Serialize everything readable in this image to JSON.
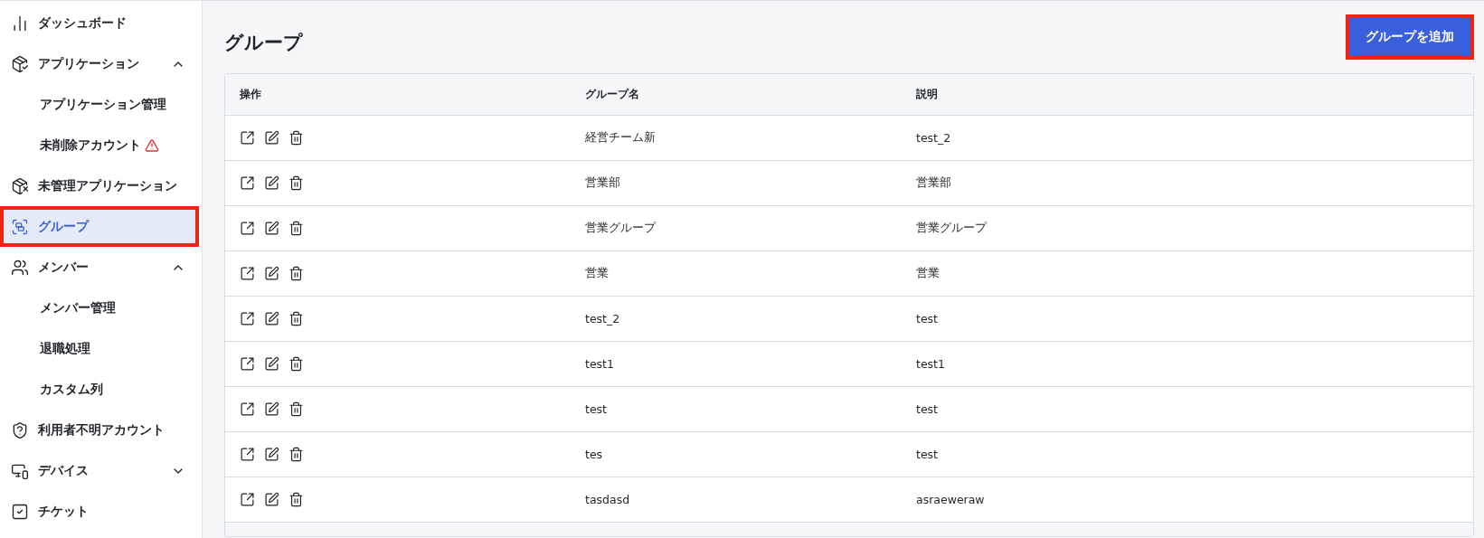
{
  "sidebar": {
    "items": [
      {
        "label": "ダッシュボード",
        "selected": false,
        "outlined": false
      },
      {
        "label": "アプリケーション",
        "selected": false,
        "outlined": false,
        "expanded": true,
        "children": [
          {
            "label": "アプリケーション管理",
            "selected": false,
            "warning": false
          },
          {
            "label": "未削除アカウント",
            "selected": false,
            "warning": true
          }
        ]
      },
      {
        "label": "未管理アプリケーション",
        "selected": false,
        "outlined": false
      },
      {
        "label": "グループ",
        "selected": true,
        "outlined": true
      },
      {
        "label": "メンバー",
        "selected": false,
        "outlined": false,
        "expanded": true,
        "children": [
          {
            "label": "メンバー管理",
            "selected": false,
            "warning": false
          },
          {
            "label": "退職処理",
            "selected": false,
            "warning": false
          },
          {
            "label": "カスタム列",
            "selected": false,
            "warning": false
          }
        ]
      },
      {
        "label": "利用者不明アカウント",
        "selected": false,
        "outlined": false
      },
      {
        "label": "デバイス",
        "selected": false,
        "outlined": false,
        "expanded": false
      },
      {
        "label": "チケット",
        "selected": false,
        "outlined": false
      }
    ]
  },
  "page": {
    "title": "グループ",
    "add_button": {
      "label": "グループを追加",
      "outlined": true
    }
  },
  "table": {
    "columns": [
      "操作",
      "グループ名",
      "説明"
    ],
    "rows": [
      {
        "name": "経営チーム新",
        "description": "test_2"
      },
      {
        "name": "営業部",
        "description": "営業部"
      },
      {
        "name": "営業グループ",
        "description": "営業グループ"
      },
      {
        "name": "営業",
        "description": "営業"
      },
      {
        "name": "test_2",
        "description": "test"
      },
      {
        "name": "test1",
        "description": "test1"
      },
      {
        "name": "test",
        "description": "test"
      },
      {
        "name": "tes",
        "description": "test"
      },
      {
        "name": "tasdasd",
        "description": "asraeweraw"
      }
    ]
  }
}
